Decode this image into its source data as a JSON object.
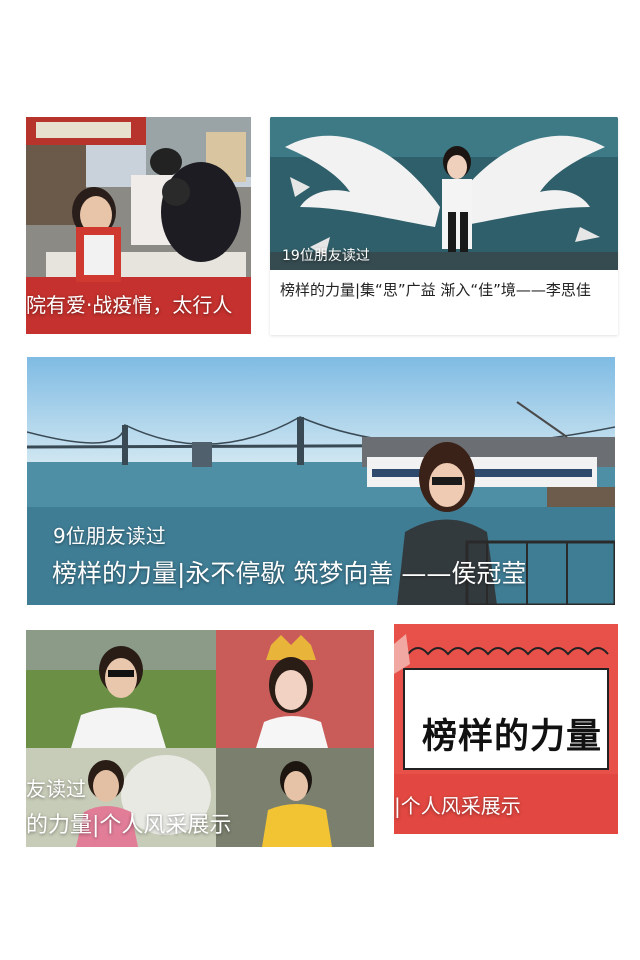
{
  "cards": [
    {
      "title": "院有爱·战疫情，太行人"
    },
    {
      "readers": "19位朋友读过",
      "title": "榜样的力量|集“思”广益 渐入“佳”境——李思佳"
    },
    {
      "readers": "9位朋友读过",
      "title": "榜样的力量|永不停歇 筑梦向善 ——侯冠莹"
    },
    {
      "readers": "友读过",
      "title": "的力量|个人风采展示"
    },
    {
      "poster_text": "榜样的力量",
      "title": "|个人风采展示"
    }
  ],
  "icons": {
    "card1_image": "volunteer-photo-icon",
    "card2_image": "angel-wings-photo-icon",
    "card3_image": "bridge-photo-icon",
    "card4_image": "portrait-collage-icon",
    "card5_image": "role-model-poster-icon"
  },
  "colors": {
    "poster_red": "#e8504a",
    "sky_blue": "#8ec6e8",
    "wing_teal": "#2f5f6a"
  }
}
